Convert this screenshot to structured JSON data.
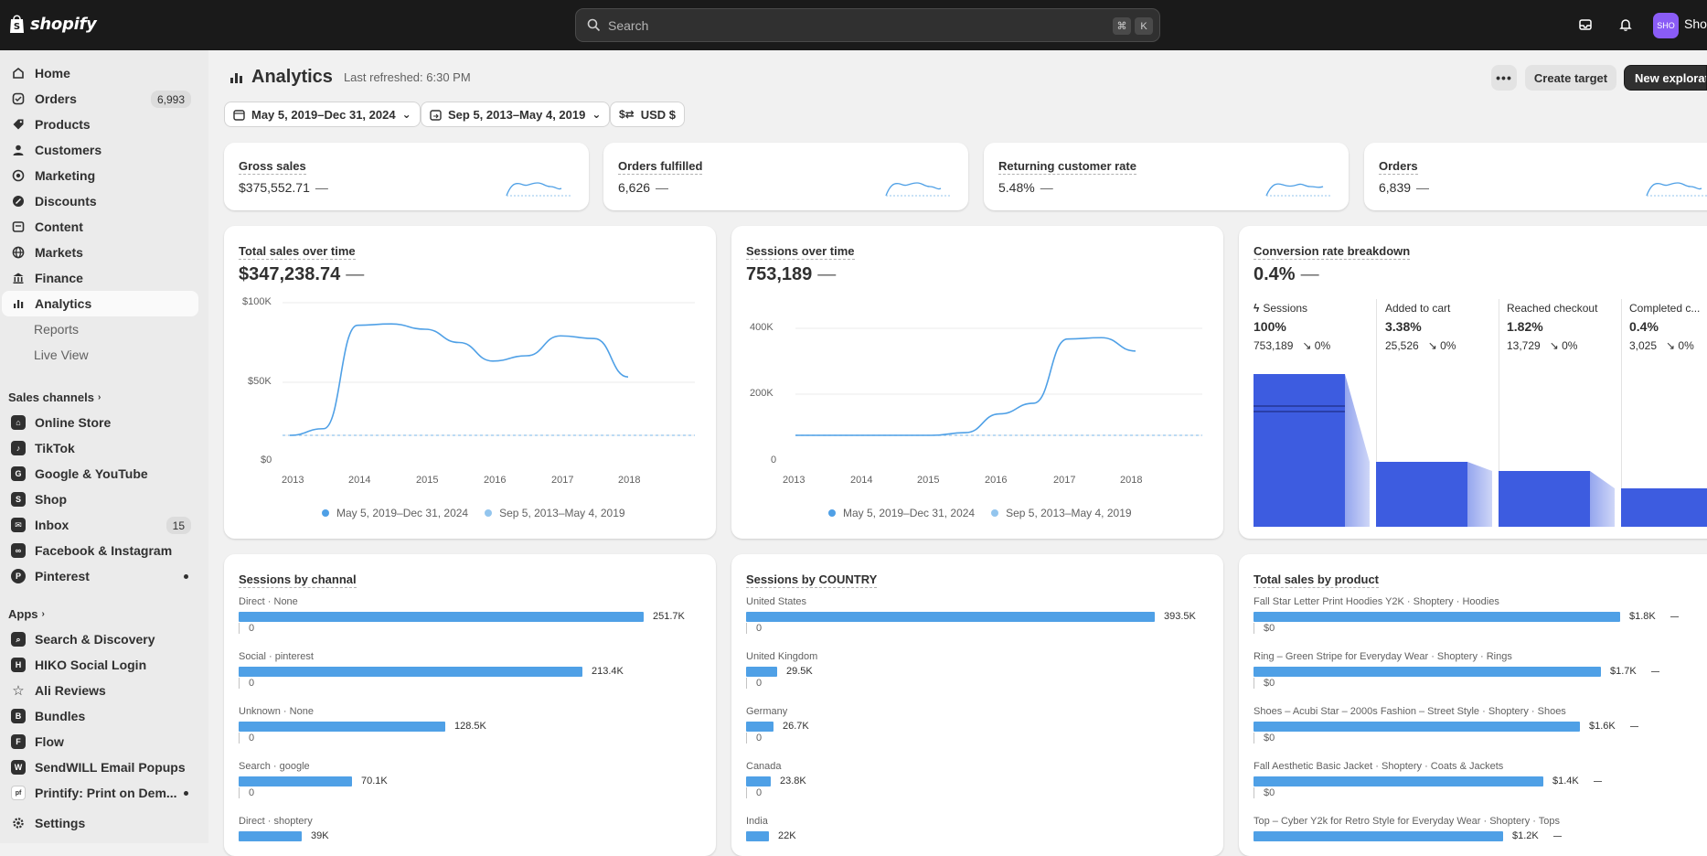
{
  "topbar": {
    "logo_text": "shopify",
    "search_placeholder": "Search",
    "kbd1": "⌘",
    "kbd2": "K",
    "avatar_initials": "SHO",
    "store_name": "Shop"
  },
  "sidebar": {
    "items": [
      {
        "label": "Home",
        "icon": "home-icon"
      },
      {
        "label": "Orders",
        "icon": "orders-icon",
        "badge": "6,993"
      },
      {
        "label": "Products",
        "icon": "tag-icon"
      },
      {
        "label": "Customers",
        "icon": "person-icon"
      },
      {
        "label": "Marketing",
        "icon": "target-icon"
      },
      {
        "label": "Discounts",
        "icon": "discount-icon"
      },
      {
        "label": "Content",
        "icon": "content-icon"
      },
      {
        "label": "Markets",
        "icon": "globe-icon"
      },
      {
        "label": "Finance",
        "icon": "bank-icon"
      },
      {
        "label": "Analytics",
        "icon": "chart-icon"
      },
      {
        "label": "Reports"
      },
      {
        "label": "Live View"
      }
    ],
    "sales_channels_title": "Sales channels",
    "channels": [
      {
        "label": "Online Store",
        "icon": "store-icon"
      },
      {
        "label": "TikTok",
        "icon": "tiktok-icon"
      },
      {
        "label": "Google & YouTube",
        "icon": "google-icon"
      },
      {
        "label": "Shop",
        "icon": "shop-icon"
      },
      {
        "label": "Inbox",
        "icon": "inbox-icon",
        "badge": "15"
      },
      {
        "label": "Facebook & Instagram",
        "icon": "facebook-icon"
      },
      {
        "label": "Pinterest",
        "icon": "pinterest-icon"
      }
    ],
    "apps_title": "Apps",
    "apps": [
      {
        "label": "Search & Discovery",
        "icon": "search-discovery-icon"
      },
      {
        "label": "HIKO Social Login",
        "icon": "hiko-icon"
      },
      {
        "label": "Ali Reviews",
        "icon": "star-icon"
      },
      {
        "label": "Bundles",
        "icon": "bundles-icon"
      },
      {
        "label": "Flow",
        "icon": "flow-icon"
      },
      {
        "label": "SendWILL Email Popups",
        "icon": "sendwill-icon"
      },
      {
        "label": "Printify: Print on Dem...",
        "icon": "printify-icon"
      }
    ],
    "settings_label": "Settings"
  },
  "header": {
    "title": "Analytics",
    "refreshed": "Last refreshed: 6:30 PM",
    "create_target": "Create target",
    "new_exploration": "New explorati"
  },
  "filters": {
    "date_range": "May 5, 2019–Dec 31, 2024",
    "compare_range": "Sep 5, 2013–May 4, 2019",
    "currency": "USD $"
  },
  "metrics": [
    {
      "title": "Gross sales",
      "value": "$375,552.71",
      "dash": "—"
    },
    {
      "title": "Orders fulfilled",
      "value": "6,626",
      "dash": "—"
    },
    {
      "title": "Returning customer rate",
      "value": "5.48%",
      "dash": "—"
    },
    {
      "title": "Orders",
      "value": "6,839",
      "dash": "—"
    }
  ],
  "sales_chart": {
    "title": "Total sales over time",
    "value": "$347,238.74",
    "dash": "—",
    "y_ticks": [
      "$100K",
      "$50K",
      "$0"
    ],
    "x_ticks": [
      "2013",
      "2014",
      "2015",
      "2016",
      "2017",
      "2018"
    ],
    "legend": [
      "May 5, 2019–Dec 31, 2024",
      "Sep 5, 2013–May 4, 2019"
    ]
  },
  "sessions_chart": {
    "title": "Sessions over time",
    "value": "753,189",
    "dash": "—",
    "y_ticks": [
      "400K",
      "200K",
      "0"
    ],
    "x_ticks": [
      "2013",
      "2014",
      "2015",
      "2016",
      "2017",
      "2018"
    ],
    "legend": [
      "May 5, 2019–Dec 31, 2024",
      "Sep 5, 2013–May 4, 2019"
    ]
  },
  "conversion": {
    "title": "Conversion rate breakdown",
    "value": "0.4%",
    "dash": "—",
    "steps": [
      {
        "label": "Sessions",
        "pct": "100%",
        "count": "753,189",
        "change": "↘ 0%"
      },
      {
        "label": "Added to cart",
        "pct": "3.38%",
        "count": "25,526",
        "change": "↘ 0%"
      },
      {
        "label": "Reached checkout",
        "pct": "1.82%",
        "count": "13,729",
        "change": "↘ 0%"
      },
      {
        "label": "Completed c...",
        "pct": "0.4%",
        "count": "3,025",
        "change": "↘ 0%"
      }
    ]
  },
  "channel_bars": {
    "title": "Sessions by channal",
    "rows": [
      {
        "label": "Direct · None",
        "value": "251.7K",
        "fraction": 1.0,
        "zero": "0"
      },
      {
        "label": "Social · pinterest",
        "value": "213.4K",
        "fraction": 0.848,
        "zero": "0"
      },
      {
        "label": "Unknown · None",
        "value": "128.5K",
        "fraction": 0.511,
        "zero": "0"
      },
      {
        "label": "Search · google",
        "value": "70.1K",
        "fraction": 0.279,
        "zero": "0"
      },
      {
        "label": "Direct · shoptery",
        "value": "39K",
        "fraction": 0.155,
        "zero": ""
      }
    ]
  },
  "country_bars": {
    "title": "Sessions by COUNTRY",
    "rows": [
      {
        "label": "United States",
        "value": "393.5K",
        "fraction": 1.0,
        "zero": "0"
      },
      {
        "label": "United Kingdom",
        "value": "29.5K",
        "fraction": 0.075,
        "zero": "0"
      },
      {
        "label": "Germany",
        "value": "26.7K",
        "fraction": 0.068,
        "zero": "0"
      },
      {
        "label": "Canada",
        "value": "23.8K",
        "fraction": 0.06,
        "zero": "0"
      },
      {
        "label": "India",
        "value": "22K",
        "fraction": 0.056,
        "zero": ""
      }
    ]
  },
  "product_bars": {
    "title": "Total sales by product",
    "rows": [
      {
        "label": "Fall Star Letter Print Hoodies Y2K · Shoptery · Hoodies",
        "value": "$1.8K",
        "fraction": 1.0,
        "zero": "$0"
      },
      {
        "label": "Ring – Green Stripe for Everyday Wear · Shoptery · Rings",
        "value": "$1.7K",
        "fraction": 0.948,
        "zero": "$0"
      },
      {
        "label": "Shoes – Acubi Star – 2000s Fashion – Street Style · Shoptery · Shoes",
        "value": "$1.6K",
        "fraction": 0.89,
        "zero": "$0"
      },
      {
        "label": "Fall Aesthetic Basic Jacket · Shoptery · Coats & Jackets",
        "value": "$1.4K",
        "fraction": 0.79,
        "zero": "$0"
      },
      {
        "label": "Top – Cyber Y2k for Retro Style for Everyday Wear · Shoptery · Tops",
        "value": "$1.2K",
        "fraction": 0.68,
        "zero": ""
      }
    ]
  },
  "colors": {
    "primary_line": "#4fa0e6",
    "compare_line": "#93c5ee",
    "funnel": "#3d5ce0"
  },
  "chart_data": [
    {
      "type": "line",
      "title": "Total sales over time",
      "x": [
        2013,
        2013.5,
        2014,
        2014.5,
        2015,
        2015.5,
        2016,
        2016.5,
        2017,
        2017.5,
        2018
      ],
      "series": [
        {
          "name": "May 5, 2019–Dec 31, 2024",
          "values": [
            0,
            5000,
            83000,
            84000,
            80000,
            70000,
            56000,
            60000,
            75000,
            73000,
            44000
          ]
        },
        {
          "name": "Sep 5, 2013–May 4, 2019",
          "values": [
            0,
            0,
            0,
            0,
            0,
            0,
            0,
            0,
            0,
            0,
            0
          ]
        }
      ],
      "ylim": [
        0,
        100000
      ]
    },
    {
      "type": "line",
      "title": "Sessions over time",
      "x": [
        2013,
        2014,
        2015,
        2015.5,
        2016,
        2016.5,
        2017,
        2017.5,
        2018
      ],
      "series": [
        {
          "name": "May 5, 2019–Dec 31, 2024",
          "values": [
            0,
            0,
            0,
            10000,
            80000,
            120000,
            360000,
            365000,
            315000
          ]
        },
        {
          "name": "Sep 5, 2013–May 4, 2019",
          "values": [
            0,
            0,
            0,
            0,
            0,
            0,
            0,
            0,
            0
          ]
        }
      ],
      "ylim": [
        0,
        400000
      ]
    }
  ]
}
